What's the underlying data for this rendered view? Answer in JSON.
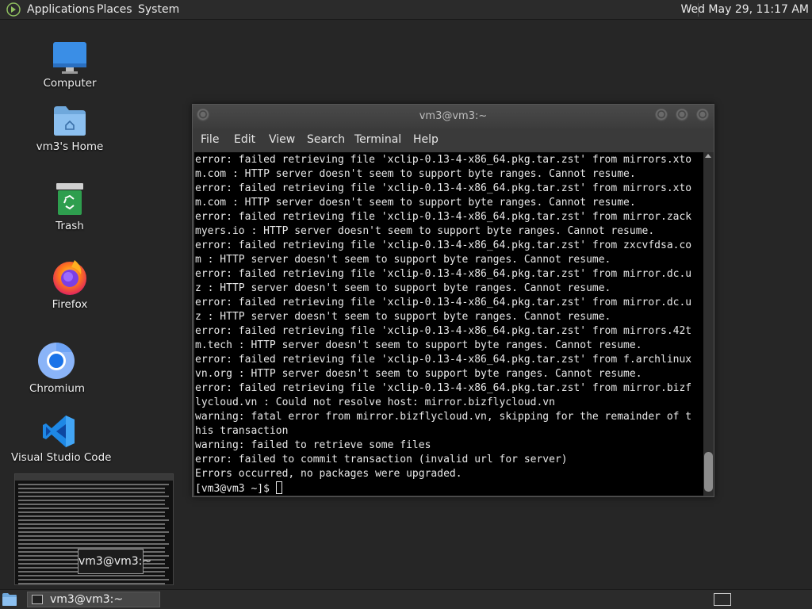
{
  "top_panel": {
    "menus": [
      "Applications",
      "Places",
      "System"
    ],
    "clock": "Wed May 29, 11:17 AM"
  },
  "desktop_icons": [
    {
      "label": "Computer",
      "icon": "computer-icon"
    },
    {
      "label": "vm3's Home",
      "icon": "home-folder-icon"
    },
    {
      "label": "Trash",
      "icon": "trash-icon"
    },
    {
      "label": "Firefox",
      "icon": "firefox-icon"
    },
    {
      "label": "Chromium",
      "icon": "chromium-icon"
    },
    {
      "label": "Visual Studio Code",
      "icon": "vscode-icon"
    }
  ],
  "terminal": {
    "title": "vm3@vm3:~",
    "menu": [
      "File",
      "Edit",
      "View",
      "Search",
      "Terminal",
      "Help"
    ],
    "lines": [
      "error: failed retrieving file 'xclip-0.13-4-x86_64.pkg.tar.zst' from mirrors.xto",
      "m.com : HTTP server doesn't seem to support byte ranges. Cannot resume.",
      "error: failed retrieving file 'xclip-0.13-4-x86_64.pkg.tar.zst' from mirrors.xto",
      "m.com : HTTP server doesn't seem to support byte ranges. Cannot resume.",
      "error: failed retrieving file 'xclip-0.13-4-x86_64.pkg.tar.zst' from mirror.zack",
      "myers.io : HTTP server doesn't seem to support byte ranges. Cannot resume.",
      "error: failed retrieving file 'xclip-0.13-4-x86_64.pkg.tar.zst' from zxcvfdsa.co",
      "m : HTTP server doesn't seem to support byte ranges. Cannot resume.",
      "error: failed retrieving file 'xclip-0.13-4-x86_64.pkg.tar.zst' from mirror.dc.u",
      "z : HTTP server doesn't seem to support byte ranges. Cannot resume.",
      "error: failed retrieving file 'xclip-0.13-4-x86_64.pkg.tar.zst' from mirror.dc.u",
      "z : HTTP server doesn't seem to support byte ranges. Cannot resume.",
      "error: failed retrieving file 'xclip-0.13-4-x86_64.pkg.tar.zst' from mirrors.42t",
      "m.tech : HTTP server doesn't seem to support byte ranges. Cannot resume.",
      "error: failed retrieving file 'xclip-0.13-4-x86_64.pkg.tar.zst' from f.archlinux",
      "vn.org : HTTP server doesn't seem to support byte ranges. Cannot resume.",
      "error: failed retrieving file 'xclip-0.13-4-x86_64.pkg.tar.zst' from mirror.bizf",
      "lycloud.vn : Could not resolve host: mirror.bizflycloud.vn",
      "warning: fatal error from mirror.bizflycloud.vn, skipping for the remainder of t",
      "his transaction",
      "warning: failed to retrieve some files",
      "error: failed to commit transaction (invalid url for server)",
      "Errors occurred, no packages were upgraded."
    ],
    "prompt": "[vm3@vm3 ~]$ "
  },
  "preview": {
    "label": "vm3@vm3:~"
  },
  "taskbar": {
    "task_label": "vm3@vm3:~"
  }
}
